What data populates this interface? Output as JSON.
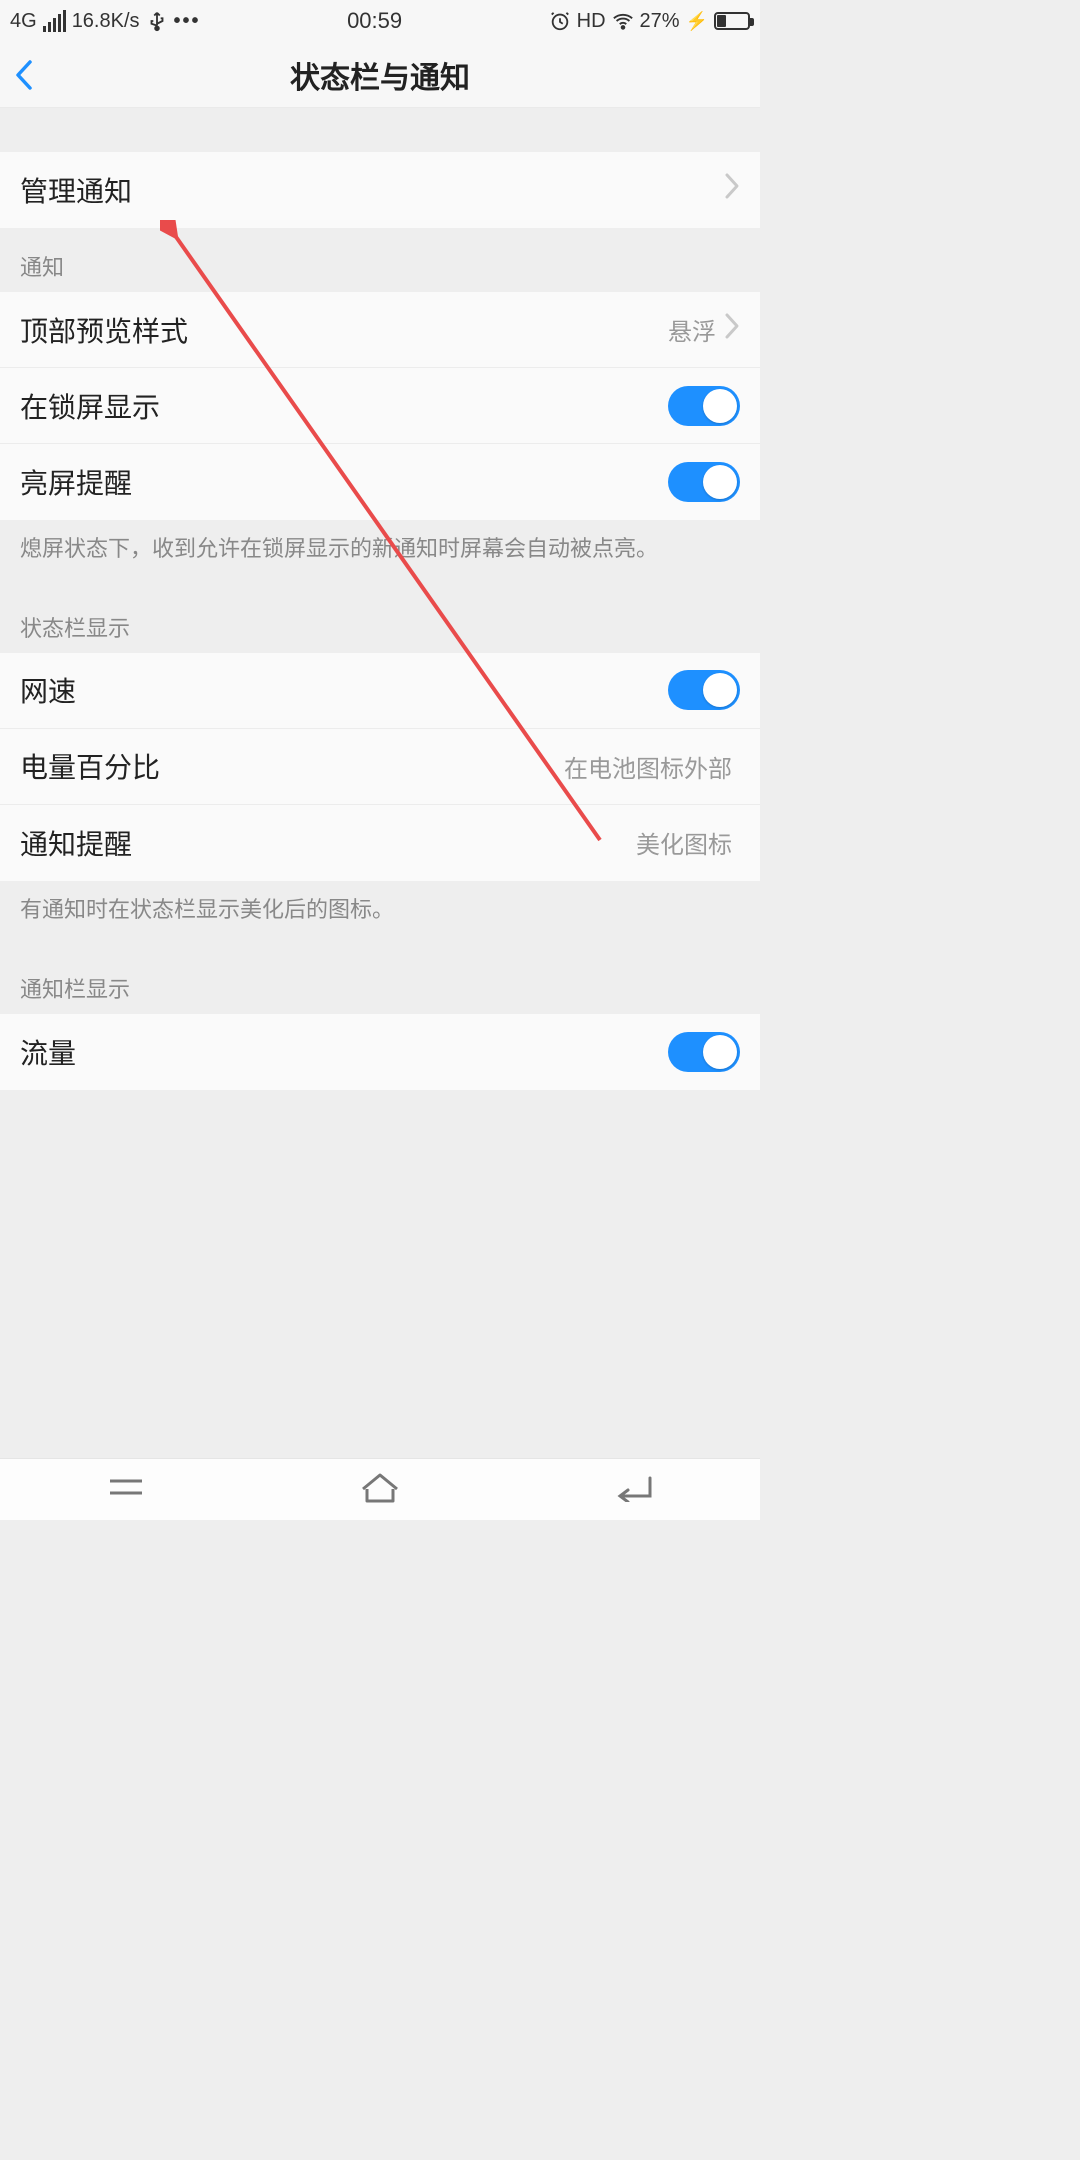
{
  "status_bar": {
    "net_type": "4G",
    "speed": "16.8K/s",
    "time": "00:59",
    "hd": "HD",
    "battery_percent": "27%"
  },
  "header": {
    "title": "状态栏与通知"
  },
  "top_item": {
    "label": "管理通知"
  },
  "section_notifications": {
    "header": "通知",
    "items": [
      {
        "label": "顶部预览样式",
        "value": "悬浮",
        "type": "chevron"
      },
      {
        "label": "在锁屏显示",
        "type": "toggle",
        "on": true
      },
      {
        "label": "亮屏提醒",
        "type": "toggle",
        "on": true
      }
    ],
    "desc": "熄屏状态下，收到允许在锁屏显示的新通知时屏幕会自动被点亮。"
  },
  "section_statusbar": {
    "header": "状态栏显示",
    "items": [
      {
        "label": "网速",
        "type": "toggle",
        "on": true
      },
      {
        "label": "电量百分比",
        "value": "在电池图标外部",
        "type": "value"
      },
      {
        "label": "通知提醒",
        "value": "美化图标",
        "type": "value"
      }
    ],
    "desc": "有通知时在状态栏显示美化后的图标。"
  },
  "section_notifpanel": {
    "header": "通知栏显示",
    "items": [
      {
        "label": "流量",
        "type": "toggle",
        "on": true
      }
    ]
  }
}
